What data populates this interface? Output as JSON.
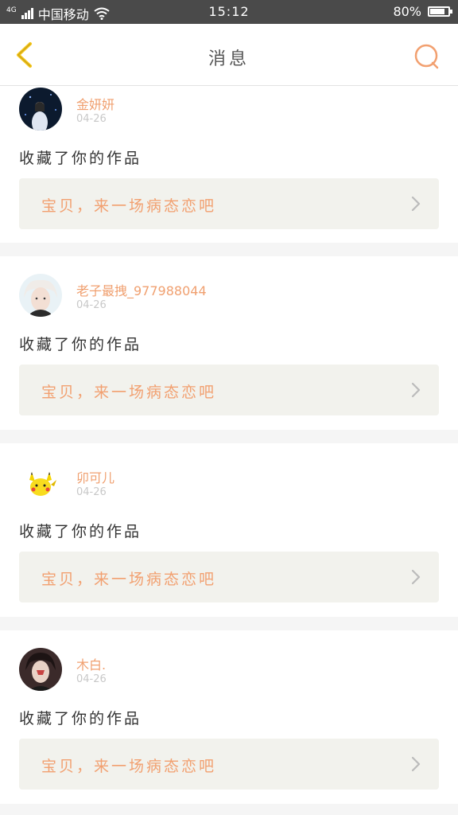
{
  "status_bar": {
    "network_label": "4G",
    "carrier": "中国移动",
    "time": "15:12",
    "battery": "80%",
    "battery_level": 0.8
  },
  "nav": {
    "title": "消息",
    "back_icon": "chevron-left-icon",
    "search_icon": "search-icon"
  },
  "colors": {
    "accent": "#f2a070",
    "back_icon": "#f5c518",
    "username": "#f0a070"
  },
  "messages": [
    {
      "username": "金妍妍",
      "date": "04-26",
      "action": "收藏了你的作品",
      "work_title": "宝贝，来一场病态恋吧"
    },
    {
      "username": "老子最拽_977988044",
      "date": "04-26",
      "action": "收藏了你的作品",
      "work_title": "宝贝，来一场病态恋吧"
    },
    {
      "username": "卯可儿",
      "date": "04-26",
      "action": "收藏了你的作品",
      "work_title": "宝贝，来一场病态恋吧"
    },
    {
      "username": "木白.",
      "date": "04-26",
      "action": "收藏了你的作品",
      "work_title": "宝贝，来一场病态恋吧"
    }
  ]
}
